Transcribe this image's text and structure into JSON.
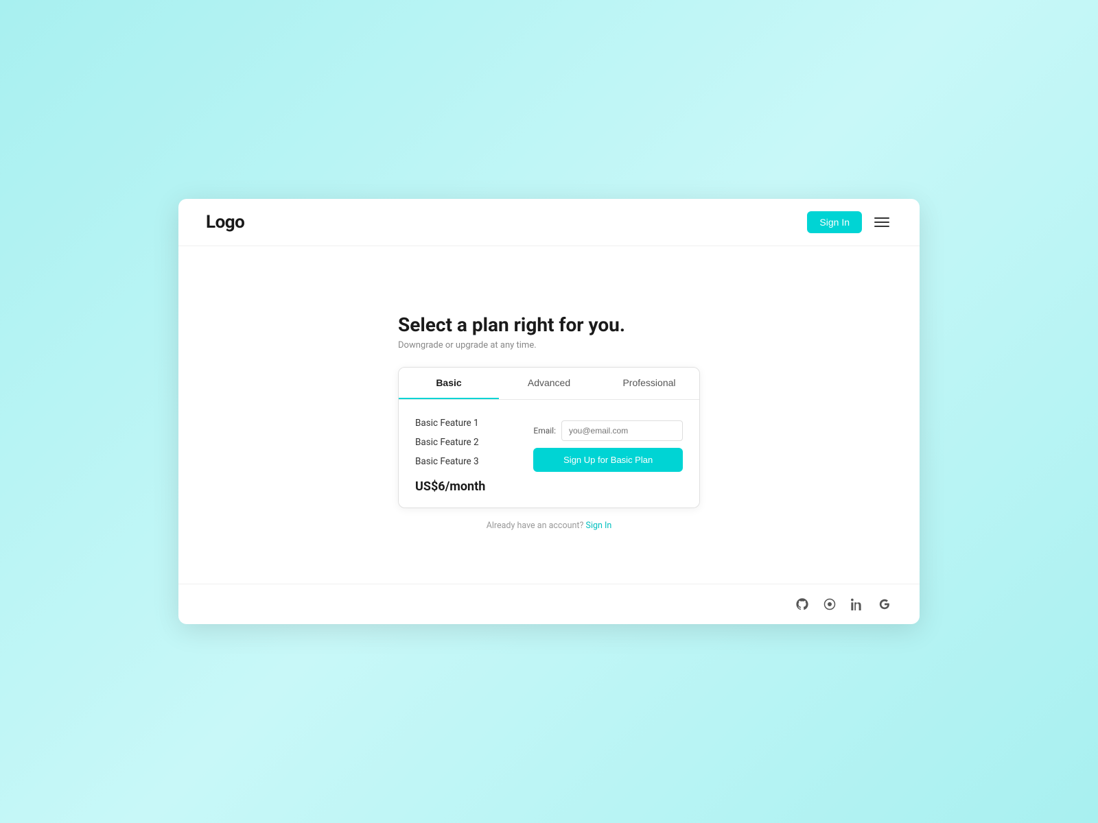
{
  "app": {
    "logo": "Logo"
  },
  "navbar": {
    "sign_in_label": "Sign In",
    "menu_icon_label": "menu"
  },
  "main": {
    "title": "Select a plan right for you.",
    "subtitle": "Downgrade or upgrade at any time.",
    "tabs": [
      {
        "id": "basic",
        "label": "Basic",
        "active": true
      },
      {
        "id": "advanced",
        "label": "Advanced",
        "active": false
      },
      {
        "id": "professional",
        "label": "Professional",
        "active": false
      }
    ],
    "plan": {
      "features": [
        "Basic Feature 1",
        "Basic Feature 2",
        "Basic Feature 3"
      ],
      "price": "US$6/month",
      "email_label": "Email:",
      "email_placeholder": "you@email.com",
      "cta_label": "Sign Up for Basic Plan"
    }
  },
  "footer": {
    "already_account_text": "Already have an account?",
    "sign_in_link_label": "Sign In",
    "icons": [
      {
        "id": "github",
        "label": "github-icon"
      },
      {
        "id": "circle",
        "label": "circle-icon"
      },
      {
        "id": "linkedin",
        "label": "linkedin-icon"
      },
      {
        "id": "google",
        "label": "google-icon"
      }
    ]
  }
}
